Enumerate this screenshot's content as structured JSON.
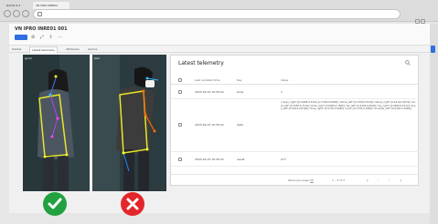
{
  "browser": {
    "tabs": [
      {
        "label": "Rofcat 6.3"
      },
      {
        "label": "VN IPRO INRE01"
      }
    ],
    "address": "",
    "icons": [
      "back-icon",
      "forward-icon",
      "reload-icon",
      "lock-icon"
    ]
  },
  "app": {
    "device_title": "VN IPRO INRE01 001",
    "edit_label": "",
    "toolbar_icons": [
      "filter-icon",
      "expand-icon",
      "share-icon",
      "more-icon"
    ]
  },
  "subtabs": [
    {
      "label": "Details",
      "active": false
    },
    {
      "label": "Latest telemetry",
      "active": true
    },
    {
      "label": "Attributes",
      "active": false
    },
    {
      "label": "Alarms",
      "active": false
    }
  ],
  "images": {
    "left_label": "good",
    "right_label": "bad"
  },
  "verdicts": {
    "good_icon": "checkmark-icon",
    "bad_icon": "cross-icon",
    "good_color": "#22a140",
    "bad_color": "#e2262a"
  },
  "telemetry": {
    "title": "Latest telemetry",
    "columns": [
      "Last updated time",
      "Key",
      "Value"
    ],
    "rows": [
      {
        "time": "2023-02-15 10:55:41",
        "key": "body",
        "value": "1"
      },
      {
        "time": "2023-02-15 10:55:41",
        "key": "data",
        "value": "{\"keys_right\":[[0.6468,0.3421],[0.7304,0.6568]],\"elbow_left\":[0.3390,0.5520],\"elbow_right\":[0.6210,0.6070],\"wrist_left\":[0.3050,0.7110],\"wrist_right\":[0.6480,0.7890],\"hip_left\":[0.4200,0.6020],\"hip_right\":[0.5600,0.6110],\"knee_left\":[0.4010,0.8120],\"knee_right\":[0.5730,0.8280],\"nose\":[0.7230,0.1860],\"shoulder_left\":[0.6150,0.3090]}"
      },
      {
        "time": "2023-02-15 10:55:41",
        "key": "result",
        "value": "277"
      }
    ],
    "pager": {
      "items_per_page_label": "Items per page:",
      "items_per_page": "30",
      "range": "1 – 3 of 3"
    }
  }
}
